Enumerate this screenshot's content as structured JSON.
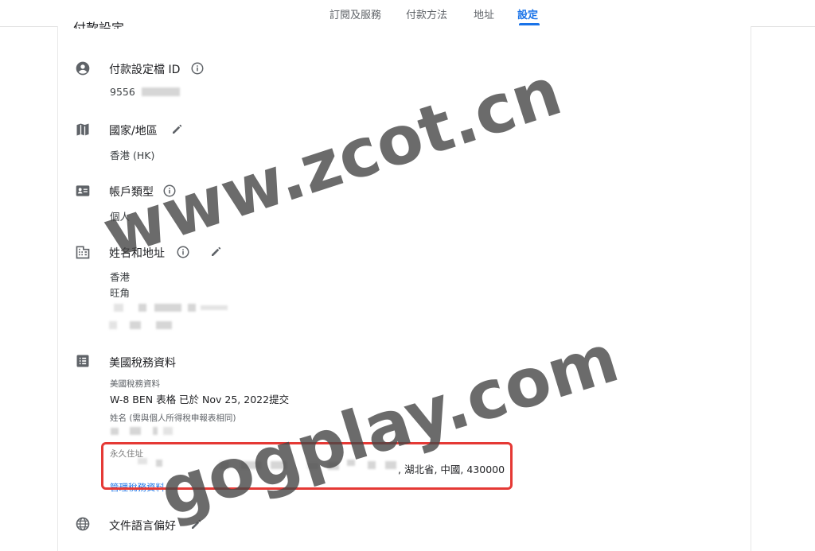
{
  "nav": {
    "tabs": [
      {
        "label": "訂閱及服務"
      },
      {
        "label": "付款方法"
      },
      {
        "label": "地址"
      },
      {
        "label": "設定",
        "active": true
      }
    ]
  },
  "section_title": "付款設定",
  "payments_profile": {
    "label": "付款設定檔 ID",
    "value": "9556"
  },
  "country": {
    "label": "國家/地區",
    "value": "香港 (HK)"
  },
  "account_type": {
    "label": "帳戶類型",
    "value": "個人"
  },
  "name_address": {
    "label": "姓名和地址",
    "line1": "香港",
    "line2": "旺角"
  },
  "us_tax": {
    "label": "美國稅務資料",
    "sub_label": "美國稅務資料",
    "form_status": "W-8 BEN 表格 已於 Nov 25, 2022提交",
    "name_label": "姓名 (需與個人所得稅申報表相同)",
    "permanent_address_label": "永久住址",
    "permanent_address_value": ", 湖北省, 中國, 430000",
    "manage_link": "管理稅務資料"
  },
  "document_language": {
    "label": "文件語言偏好"
  },
  "watermarks": {
    "top": "www.zcot.cn",
    "bottom": "gogplay.com"
  },
  "colors": {
    "accent": "#1a73e8",
    "highlight": "#e53935",
    "icon": "#5f6368"
  }
}
